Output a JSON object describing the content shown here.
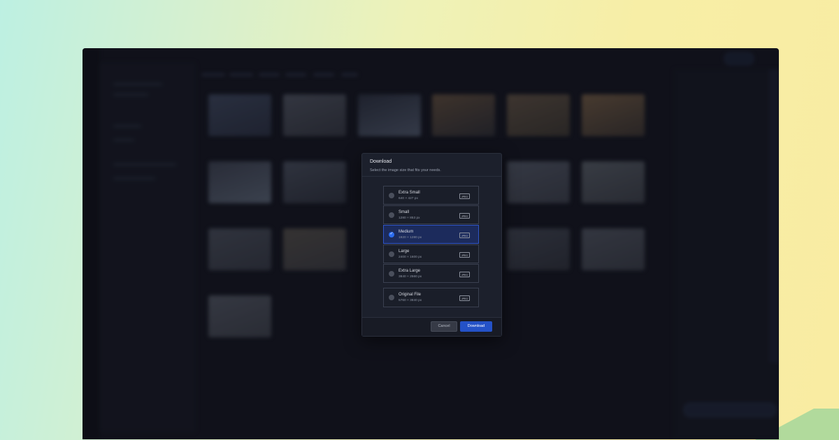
{
  "modal": {
    "title": "Download",
    "subtitle": "Select the image size that fits your needs.",
    "options": [
      {
        "name": "Extra Small",
        "dims": "640 × 427 px",
        "format": "JPEG",
        "selected": false
      },
      {
        "name": "Small",
        "dims": "1280 × 853 px",
        "format": "JPEG",
        "selected": false
      },
      {
        "name": "Medium",
        "dims": "1920 × 1280 px",
        "format": "JPEG",
        "selected": true
      },
      {
        "name": "Large",
        "dims": "2400 × 1600 px",
        "format": "JPEG",
        "selected": false
      },
      {
        "name": "Extra Large",
        "dims": "3840 × 2560 px",
        "format": "JPEG",
        "selected": false
      }
    ],
    "original": {
      "name": "Original File",
      "dims": "5760 × 3840 px",
      "format": "JPEG",
      "selected": false
    },
    "cancel_label": "Cancel",
    "download_label": "Download"
  },
  "colors": {
    "accent": "#2452c7",
    "selected_bg": "#1c2b5c",
    "modal_bg": "#1c202c"
  },
  "icons": {
    "check": "check-icon",
    "radio": "radio-icon"
  }
}
